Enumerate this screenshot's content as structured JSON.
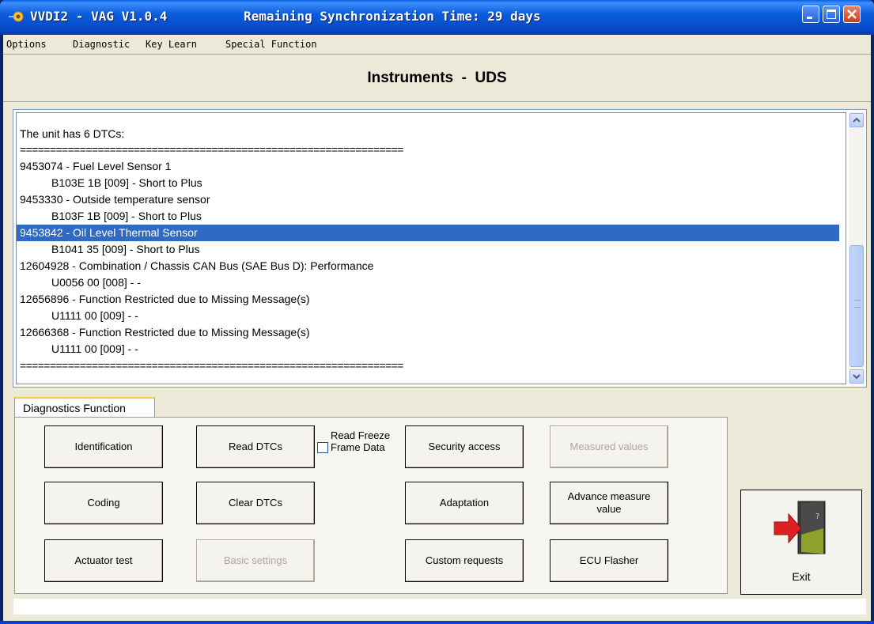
{
  "window": {
    "title": "VVDI2 - VAG V1.0.4",
    "sync_status": "Remaining Synchronization Time: 29 days"
  },
  "menu": {
    "items": [
      "Options",
      "Diagnostic",
      "Key Learn",
      "Special Function"
    ]
  },
  "header": {
    "title": "Instruments  -  UDS"
  },
  "output": {
    "lines": [
      {
        "text": "The unit has 6 DTCs:"
      },
      {
        "text": "================================================================"
      },
      {
        "text": "9453074 - Fuel Level Sensor 1"
      },
      {
        "text": "B103E 1B [009] - Short to Plus"
      },
      {
        "text": "9453330 - Outside temperature sensor"
      },
      {
        "text": "B103F 1B [009] - Short to Plus"
      },
      {
        "text": "9453842 - Oil Level Thermal Sensor"
      },
      {
        "text": "B1041 35 [009] - Short to Plus"
      },
      {
        "text": "12604928 - Combination / Chassis CAN Bus (SAE Bus D): Performance"
      },
      {
        "text": "U0056 00 [008] - -"
      },
      {
        "text": "12656896 - Function Restricted due to Missing Message(s)"
      },
      {
        "text": "U1111 00 [009] - -"
      },
      {
        "text": "12666368 - Function Restricted due to Missing Message(s)"
      },
      {
        "text": "U1111 00 [009] - -"
      },
      {
        "text": "================================================================"
      }
    ],
    "selected_line": "9453842 - Oil Level Thermal Sensor"
  },
  "tabs": {
    "active": "Diagnostics Function"
  },
  "functions": {
    "identification": "Identification",
    "read_dtcs": "Read DTCs",
    "read_freeze_frame": "Read Freeze Frame Data",
    "read_freeze_frame_checked": false,
    "security_access": "Security access",
    "measured_values": "Measured values",
    "coding": "Coding",
    "clear_dtcs": "Clear DTCs",
    "adaptation": "Adaptation",
    "advance_measure_value": "Advance measure value",
    "actuator_test": "Actuator test",
    "basic_settings": "Basic settings",
    "custom_requests": "Custom requests",
    "ecu_flasher": "ECU Flasher"
  },
  "exit": {
    "label": "Exit",
    "icon": "exit-door-icon"
  },
  "status_bar": {
    "text": ""
  },
  "colors": {
    "title_bar": "#0b5ddc",
    "selection": "#316ac5",
    "face": "#ece9d8"
  }
}
